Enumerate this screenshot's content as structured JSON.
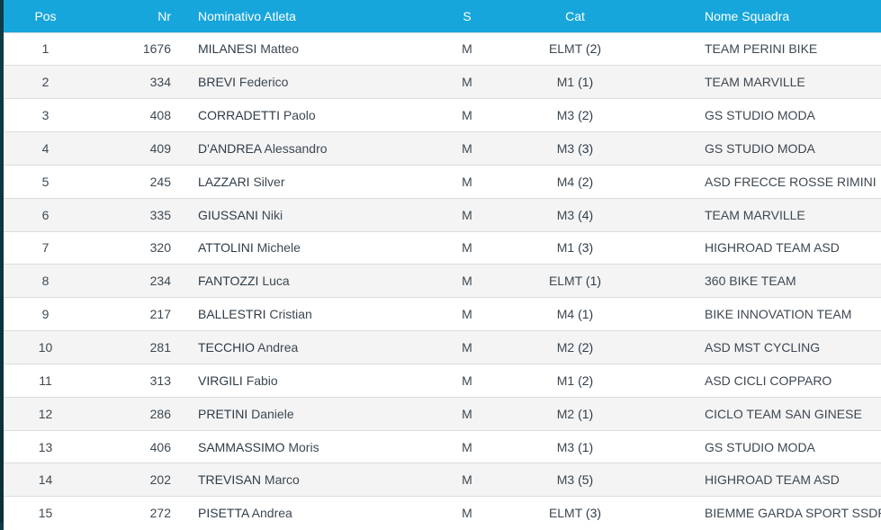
{
  "table": {
    "headers": {
      "pos": "Pos",
      "nr": "Nr",
      "name": "Nominativo Atleta",
      "sex": "S",
      "cat": "Cat",
      "team": "Nome Squadra"
    },
    "rows": [
      {
        "pos": "1",
        "nr": "1676",
        "surname": "MILANESI",
        "first": "Matteo",
        "sex": "M",
        "cat": "ELMT",
        "cat_rank": "(2)",
        "team": "TEAM PERINI BIKE"
      },
      {
        "pos": "2",
        "nr": "334",
        "surname": "BREVI",
        "first": "Federico",
        "sex": "M",
        "cat": "M1",
        "cat_rank": "(1)",
        "team": "TEAM MARVILLE"
      },
      {
        "pos": "3",
        "nr": "408",
        "surname": "CORRADETTI",
        "first": "Paolo",
        "sex": "M",
        "cat": "M3",
        "cat_rank": "(2)",
        "team": "GS STUDIO MODA"
      },
      {
        "pos": "4",
        "nr": "409",
        "surname": "D'ANDREA",
        "first": "Alessandro",
        "sex": "M",
        "cat": "M3",
        "cat_rank": "(3)",
        "team": "GS STUDIO MODA"
      },
      {
        "pos": "5",
        "nr": "245",
        "surname": "LAZZARI",
        "first": "Silver",
        "sex": "M",
        "cat": "M4",
        "cat_rank": "(2)",
        "team": "ASD FRECCE ROSSE RIMINI"
      },
      {
        "pos": "6",
        "nr": "335",
        "surname": "GIUSSANI",
        "first": "Niki",
        "sex": "M",
        "cat": "M3",
        "cat_rank": "(4)",
        "team": "TEAM MARVILLE"
      },
      {
        "pos": "7",
        "nr": "320",
        "surname": "ATTOLINI",
        "first": "Michele",
        "sex": "M",
        "cat": "M1",
        "cat_rank": "(3)",
        "team": "HIGHROAD TEAM ASD"
      },
      {
        "pos": "8",
        "nr": "234",
        "surname": "FANTOZZI",
        "first": "Luca",
        "sex": "M",
        "cat": "ELMT",
        "cat_rank": "(1)",
        "team": "360 BIKE TEAM"
      },
      {
        "pos": "9",
        "nr": "217",
        "surname": "BALLESTRI",
        "first": "Cristian",
        "sex": "M",
        "cat": "M4",
        "cat_rank": "(1)",
        "team": "BIKE INNOVATION TEAM"
      },
      {
        "pos": "10",
        "nr": "281",
        "surname": "TECCHIO",
        "first": "Andrea",
        "sex": "M",
        "cat": "M2",
        "cat_rank": "(2)",
        "team": "ASD MST CYCLING"
      },
      {
        "pos": "11",
        "nr": "313",
        "surname": "VIRGILI",
        "first": "Fabio",
        "sex": "M",
        "cat": "M1",
        "cat_rank": "(2)",
        "team": "ASD CICLI COPPARO"
      },
      {
        "pos": "12",
        "nr": "286",
        "surname": "PRETINI",
        "first": "Daniele",
        "sex": "M",
        "cat": "M2",
        "cat_rank": "(1)",
        "team": "CICLO TEAM SAN GINESE"
      },
      {
        "pos": "13",
        "nr": "406",
        "surname": "SAMMASSIMO",
        "first": "Moris",
        "sex": "M",
        "cat": "M3",
        "cat_rank": "(1)",
        "team": "GS STUDIO MODA"
      },
      {
        "pos": "14",
        "nr": "202",
        "surname": "TREVISAN",
        "first": "Marco",
        "sex": "M",
        "cat": "M3",
        "cat_rank": "(5)",
        "team": "HIGHROAD TEAM ASD"
      },
      {
        "pos": "15",
        "nr": "272",
        "surname": "PISETTA",
        "first": "Andrea",
        "sex": "M",
        "cat": "ELMT",
        "cat_rank": "(3)",
        "team": "BIEMME GARDA SPORT SSDRL"
      }
    ]
  },
  "colors": {
    "header_bg": "#17a6dc",
    "row_odd": "#ffffff",
    "row_even": "#f4f4f4",
    "text": "#3d4852"
  }
}
